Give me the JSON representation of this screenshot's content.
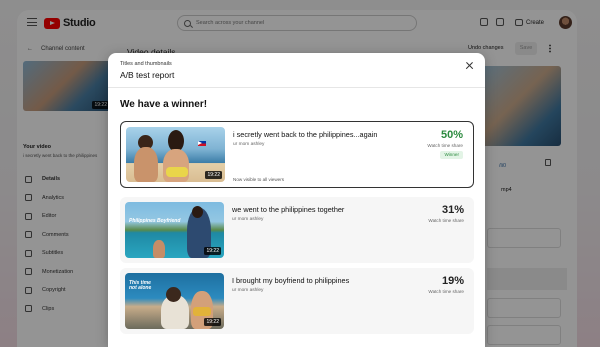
{
  "studio": {
    "logo_text": "Studio",
    "search_placeholder": "Search across your channel",
    "create_label": "Create",
    "channel_content": "Channel content",
    "your_video": "Your video",
    "your_video_title": "i secretly went back to the philippines",
    "thumb_duration": "19:22",
    "page_title": "Video details",
    "undo_label": "Undo changes",
    "save_label": "Save",
    "right_link": "/li0",
    "right_file": "mp4",
    "sidebar": [
      {
        "label": "Details",
        "icon": "pencil-icon",
        "active": true
      },
      {
        "label": "Analytics",
        "icon": "bar-chart-icon",
        "active": false
      },
      {
        "label": "Editor",
        "icon": "film-icon",
        "active": false
      },
      {
        "label": "Comments",
        "icon": "comment-icon",
        "active": false
      },
      {
        "label": "Subtitles",
        "icon": "subtitles-icon",
        "active": false
      },
      {
        "label": "Monetization",
        "icon": "dollar-icon",
        "active": false
      },
      {
        "label": "Copyright",
        "icon": "copyright-icon",
        "active": false
      },
      {
        "label": "Clips",
        "icon": "scissors-icon",
        "active": false
      }
    ]
  },
  "modal": {
    "subtitle": "Titles and thumbnails",
    "title": "A/B test report",
    "heading": "We have a winner!",
    "close_icon": "close-icon",
    "variants": [
      {
        "title": "i secretly went back to the philippines...again",
        "author": "ur mom ashley",
        "percent": "50%",
        "metric": "Watch time share",
        "badge": "Winner",
        "note": "Now visible to all viewers",
        "duration": "19:22"
      },
      {
        "title": "we went to the philippines together",
        "author": "ur mom ashley",
        "percent": "31%",
        "metric": "Watch time share",
        "duration": "19:22",
        "overlay": "Philippines Boyfriend"
      },
      {
        "title": "I brought my boyfriend to philippines",
        "author": "ur mom ashley",
        "percent": "19%",
        "metric": "Watch time share",
        "duration": "19:22",
        "overlay": "This time not alone"
      }
    ]
  },
  "colors": {
    "winner_green": "#2b8a3e",
    "winner_badge_bg": "#e3f4e6",
    "brand_red": "#ff0000"
  }
}
